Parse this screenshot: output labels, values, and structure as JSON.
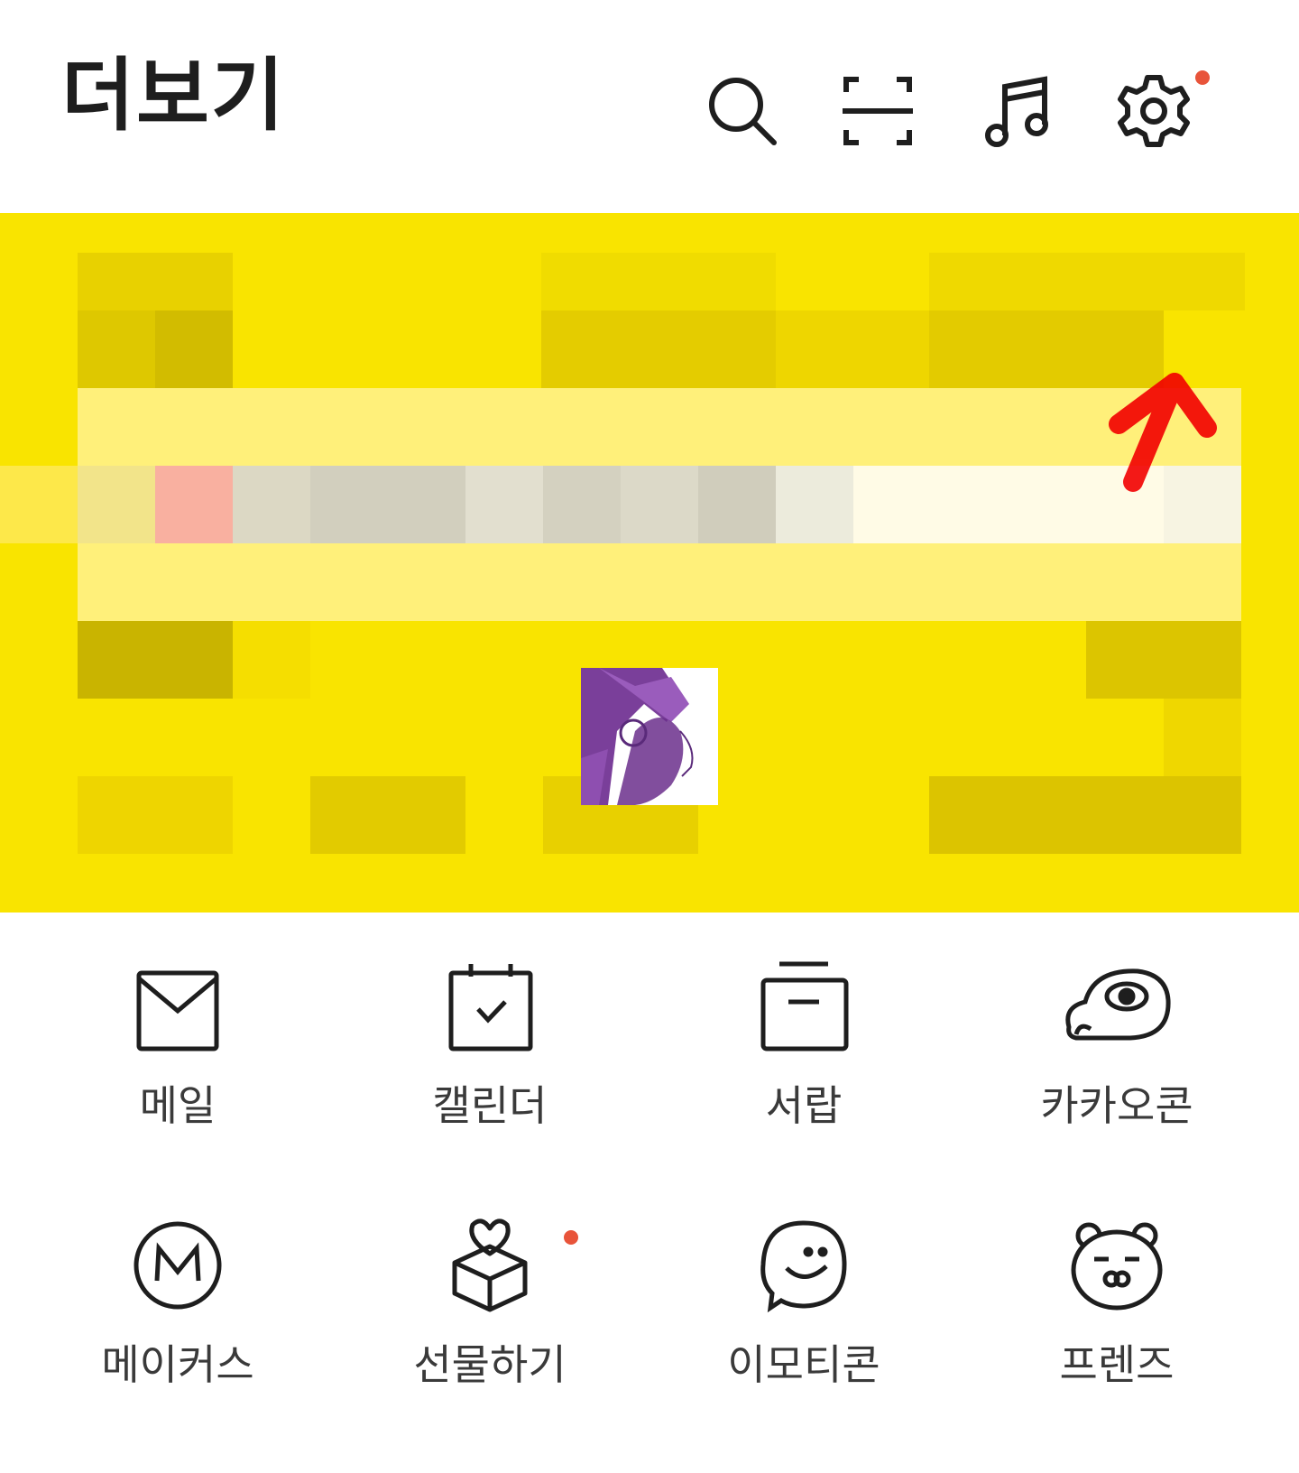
{
  "header": {
    "title": "더보기",
    "icons": [
      "search-icon",
      "scan-icon",
      "music-icon",
      "settings-icon"
    ],
    "settings_badge_color": "#e8543a"
  },
  "banner": {
    "background": "#f9e400",
    "content": "pixelated"
  },
  "menu": {
    "items": [
      {
        "label": "메일",
        "icon": "mail-icon"
      },
      {
        "label": "캘린더",
        "icon": "calendar-icon"
      },
      {
        "label": "서랍",
        "icon": "drawer-icon"
      },
      {
        "label": "카카오콘",
        "icon": "kakaocon-icon"
      },
      {
        "label": "메이커스",
        "icon": "makers-icon"
      },
      {
        "label": "선물하기",
        "icon": "gift-icon",
        "badge": true
      },
      {
        "label": "이모티콘",
        "icon": "emoticon-icon"
      },
      {
        "label": "프렌즈",
        "icon": "friends-icon"
      }
    ],
    "badge_color": "#e8543a"
  }
}
